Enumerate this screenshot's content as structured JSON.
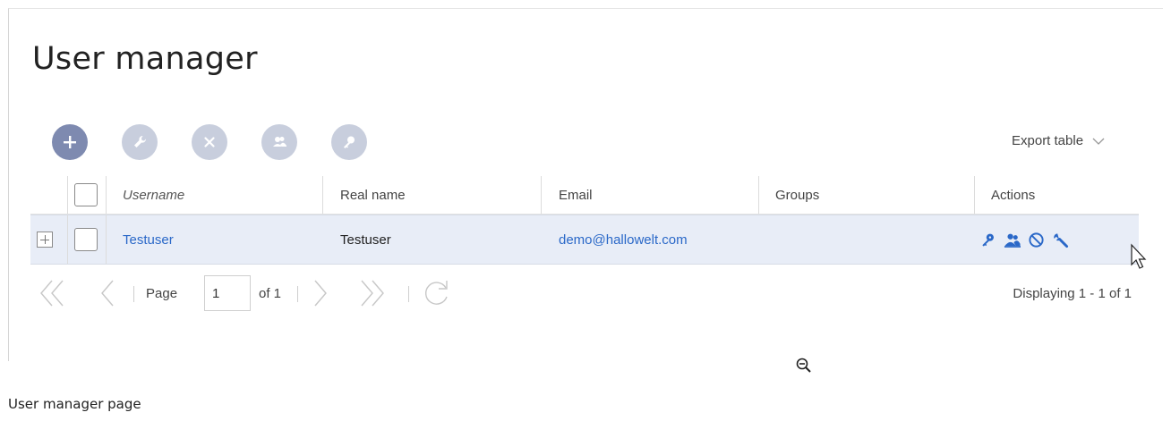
{
  "page": {
    "title": "User manager",
    "caption": "User manager page"
  },
  "toolbar": {
    "buttons": [
      {
        "name": "add-user",
        "icon": "plus-icon",
        "enabled": true
      },
      {
        "name": "edit-user",
        "icon": "wrench-icon",
        "enabled": false
      },
      {
        "name": "delete-user",
        "icon": "close-icon",
        "enabled": false
      },
      {
        "name": "groups",
        "icon": "users-icon",
        "enabled": false
      },
      {
        "name": "password",
        "icon": "key-icon",
        "enabled": false
      }
    ],
    "export_label": "Export table"
  },
  "grid": {
    "columns": {
      "username": "Username",
      "real_name": "Real name",
      "email": "Email",
      "groups": "Groups",
      "actions": "Actions"
    },
    "rows": [
      {
        "username": "Testuser",
        "real_name": "Testuser",
        "email": "demo@hallowelt.com",
        "groups": "",
        "actions": [
          "key-icon",
          "users-icon",
          "block-icon",
          "wrench-icon"
        ]
      }
    ]
  },
  "pager": {
    "page_label": "Page",
    "current_page": "1",
    "of_label": "of 1",
    "displaying": "Displaying 1 - 1 of 1"
  },
  "colors": {
    "accent": "#2a68c8",
    "toolbar_primary": "#7e8ab0",
    "toolbar_disabled": "#c8cedd",
    "row_selected": "#e8edf7"
  }
}
